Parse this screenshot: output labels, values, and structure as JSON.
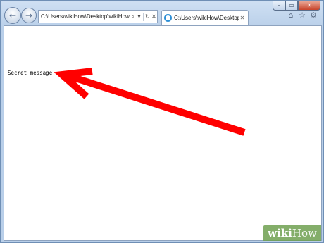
{
  "address_bar": {
    "url_text": "C:\\Users\\wikiHow\\Desktop\\wikiHow",
    "search_glyph": "⌕",
    "dropdown_glyph": "▾",
    "refresh_glyph": "↻",
    "stop_glyph": "✕"
  },
  "tab": {
    "title": "C:\\Users\\wikiHow\\Desktop...",
    "close_glyph": "✕"
  },
  "nav": {
    "back_glyph": "←",
    "forward_glyph": "→"
  },
  "window_controls": {
    "minimize_glyph": "–",
    "maximize_glyph": "▭",
    "close_glyph": "✕"
  },
  "toolbar": {
    "home_glyph": "⌂",
    "favorites_glyph": "☆",
    "tools_glyph": "⚙"
  },
  "page": {
    "message": "Secret message"
  },
  "annotation": {
    "arrow_color": "#ff0000"
  },
  "watermark": {
    "brand_a": "wiki",
    "brand_b": "How"
  }
}
